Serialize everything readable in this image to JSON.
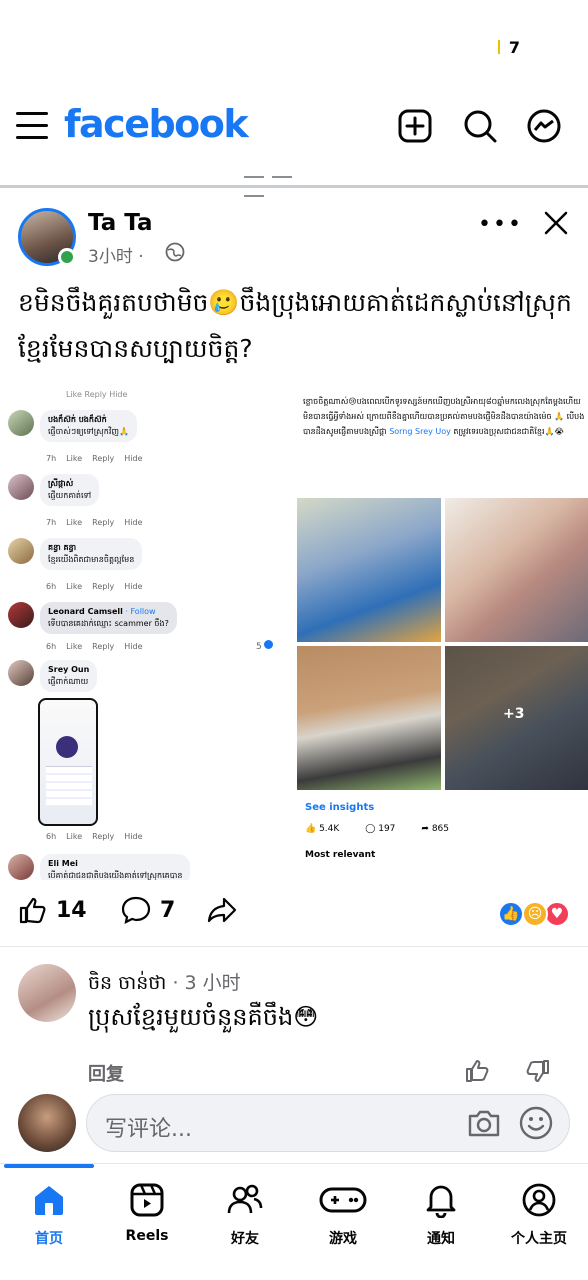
{
  "status_bar": {
    "indicator": "7"
  },
  "header": {
    "logo": "facebook"
  },
  "post": {
    "author": "Ta Ta",
    "time": "3小时 ·",
    "caption": "ខមិនចឹងគួរតបថាមិច🥲ចឹងប្រុងអោយគាត់ដេកស្លាប់នៅស្រុកខ្មែរមែនបានសប្បាយចិត្ត?",
    "embedded": {
      "left_comments": [
        {
          "name": "Like  Reply  Hide",
          "text": "",
          "acts": "7h"
        },
        {
          "name": "បងក៏ស៊ក់ បងក៏ស៊ក់",
          "text": "ផ្ញើចាស់ៗឲ្យទៅស្រុកវិញ🙏",
          "acts": [
            "7h",
            "Like",
            "Reply",
            "Hide"
          ]
        },
        {
          "name": "ស្រីផ្កាស់",
          "text": "ផ្ញើយកគាត់ទៅ",
          "acts": [
            "7h",
            "Like",
            "Reply",
            "Hide"
          ]
        },
        {
          "name": "គន្ធា គន្ធា",
          "text": "ខ្មែរយើងពិតជាមានចិត្តល្អមែន",
          "acts": [
            "6h",
            "Like",
            "Reply",
            "Hide"
          ]
        },
        {
          "name": "Leonard Camsell",
          "follow": "· Follow",
          "text": "ទើបបានគេដាក់ឈ្មោះ scammer ចឹង?",
          "acts": [
            "6h",
            "Like",
            "Reply",
            "Hide"
          ],
          "reaction_count": "5"
        },
        {
          "name": "Srey Oun",
          "text": "ផ្ញើពាក់ណាយ",
          "acts": [
            "6h",
            "Like",
            "Reply",
            "Hide"
          ]
        },
        {
          "name": "Eli Mei",
          "text": "បើគាត់ជាជនជាតិបងយើងគាត់ទៅស្រុកគេបាន",
          "acts": []
        }
      ],
      "right": {
        "text": "ខ្លោចចិត្តណាស់😢បងពេលបើកទូរទស្សន៍មកឃើញបងស្រីអាយុ៨០ឆ្នាំមកលេងស្រុកតែម្តងហើយ មិនបានធ្វើអ្វីទាំងអស់ ក្រោយពីខឹងគ្នាហើយបានប្រគល់តាមបងផ្ញើមិនដឹងបានយ៉ាងម៉េច 🙏 បើបងបានដឹងសូមផ្ញើតាមបងស្រីផ្កា",
        "tag": "Sorng Srey Uoy",
        "text2": "តម្រូវទេរបងប្រុសជាជនជាតិខ្មែរ🙏😭",
        "plus": "+3",
        "insights": "See insights",
        "likes": "5.4K",
        "comments": "197",
        "shares": "865",
        "sort": "Most relevant"
      }
    },
    "reactions": {
      "likes": "14",
      "comments": "7"
    }
  },
  "comment": {
    "name": "ចិន ចាន់ថា",
    "time": "· 3 小时",
    "text": "ប្រុសខ្មែរមួយចំនួនគឺចឹង😳",
    "reply": "回复"
  },
  "composer": {
    "placeholder": "写评论..."
  },
  "tabs": [
    {
      "label": "首页"
    },
    {
      "label": "Reels"
    },
    {
      "label": "好友"
    },
    {
      "label": "游戏"
    },
    {
      "label": "通知"
    },
    {
      "label": "个人主页"
    }
  ],
  "colors": {
    "brand": "#1877f2",
    "online": "#31a24c"
  }
}
